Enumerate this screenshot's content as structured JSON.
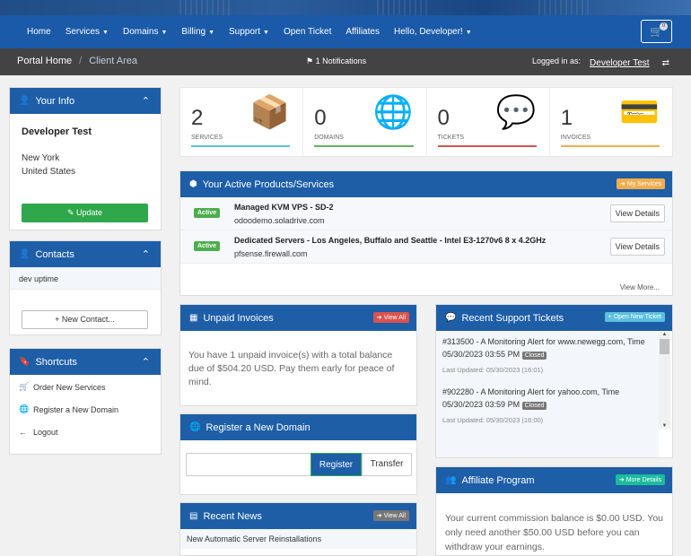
{
  "nav": {
    "home": "Home",
    "services": "Services",
    "domains": "Domains",
    "billing": "Billing",
    "support": "Support",
    "open_ticket": "Open Ticket",
    "affiliates": "Affiliates",
    "hello": "Hello, Developer!",
    "cart_count": "0"
  },
  "breadcrumb": {
    "home": "Portal Home",
    "current": "Client Area"
  },
  "notifications": "1 Notifications",
  "logged_in": {
    "label": "Logged in as:",
    "user": "Developer Test"
  },
  "your_info": {
    "title": "Your Info",
    "name": "Developer Test",
    "city": "New York",
    "country": "United States",
    "update": "Update"
  },
  "contacts": {
    "title": "Contacts",
    "item": "dev uptime",
    "new_button": "New Contact..."
  },
  "shortcuts": {
    "title": "Shortcuts",
    "items": [
      "Order New Services",
      "Register a New Domain",
      "Logout"
    ]
  },
  "stats": [
    {
      "value": "2",
      "label": "SERVICES",
      "color": "#5bc0de"
    },
    {
      "value": "0",
      "label": "DOMAINS",
      "color": "#5cb85c"
    },
    {
      "value": "0",
      "label": "TICKETS",
      "color": "#d9534f"
    },
    {
      "value": "1",
      "label": "INVOICES",
      "color": "#f0ad4e"
    }
  ],
  "products": {
    "title": "Your Active Products/Services",
    "button": "My Services",
    "items": [
      {
        "status": "Active",
        "name": "Managed KVM VPS - SD-2",
        "host": "odoodemo.soladrive.com",
        "action": "View Details"
      },
      {
        "status": "Active",
        "name": "Dedicated Servers - Los Angeles, Buffalo and Seattle - Intel E3-1270v6 8 x 4.2GHz",
        "host": "pfsense.firewall.com",
        "action": "View Details"
      }
    ],
    "view_more": "View More..."
  },
  "invoices": {
    "title": "Unpaid Invoices",
    "button": "View All",
    "text": "You have 1 unpaid invoice(s) with a total balance due of $504.20 USD. Pay them early for peace of mind."
  },
  "tickets": {
    "title": "Recent Support Tickets",
    "button": "Open New Ticket",
    "items": [
      {
        "title": "#313500 - A Monitoring Alert for www.newegg.com, Time 05/30/2023 03:55 PM",
        "status": "Closed",
        "updated": "Last Updated: 05/30/2023 (16:01)"
      },
      {
        "title": "#902280 - A Monitoring Alert for yahoo.com, Time 05/30/2023 03:59 PM",
        "status": "Closed",
        "updated": "Last Updated: 05/30/2023 (16:00)"
      }
    ]
  },
  "domain": {
    "title": "Register a New Domain",
    "register": "Register",
    "transfer": "Transfer"
  },
  "news": {
    "title": "Recent News",
    "button": "View All",
    "item": "New Automatic Server Reinstallations"
  },
  "affiliate": {
    "title": "Affiliate Program",
    "button": "More Details",
    "text": "Your current commission balance is $0.00 USD. You only need another $50.00 USD before you can withdraw your earnings."
  }
}
